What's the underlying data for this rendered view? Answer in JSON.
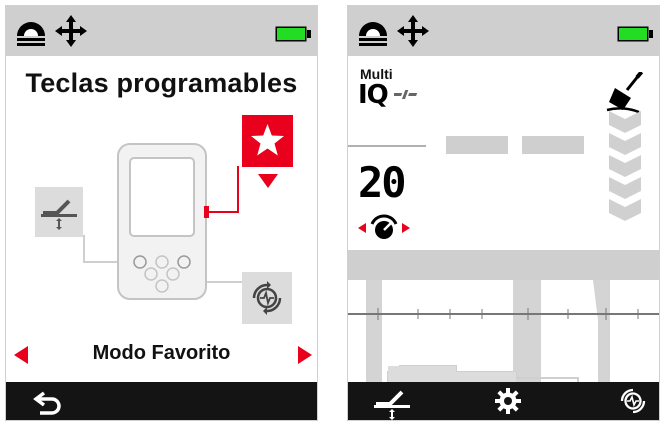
{
  "left_screen": {
    "title": "Teclas programables",
    "favorite_mode_label": "Modo Favorito",
    "battery_color": "#22dd22",
    "accent_red": "#e8001c",
    "icons": [
      "terrain-icon",
      "move-arrows-icon",
      "battery-icon",
      "star-icon",
      "ground-balance-icon",
      "recovery-speed-icon",
      "back-icon"
    ]
  },
  "right_screen": {
    "mode_label": "Multi",
    "mode_logo": "IQ",
    "sensitivity_value": "20",
    "battery_color": "#22dd22",
    "icons": [
      "terrain-icon",
      "move-arrows-icon",
      "battery-icon",
      "shovel-icon",
      "depth-chevrons-icon",
      "knob-icon",
      "ground-balance-icon",
      "gear-icon",
      "recovery-speed-icon"
    ]
  }
}
